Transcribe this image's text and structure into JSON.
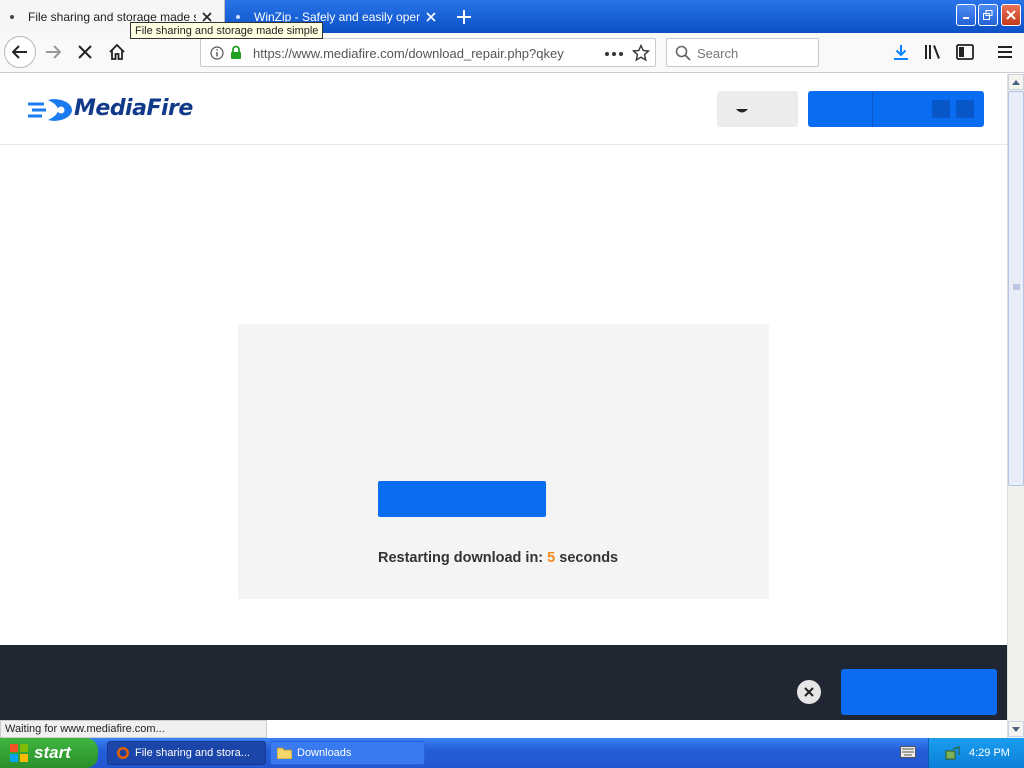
{
  "browser": {
    "tabs": [
      {
        "label": "File sharing and storage made simple",
        "active": true
      },
      {
        "label": "WinZip - Safely and easily open your",
        "active": false
      }
    ],
    "tooltip": "File sharing and storage made simple",
    "url": "https://www.mediafire.com/download_repair.php?qkey",
    "search_placeholder": "Search",
    "status_text": "Waiting for www.mediafire.com..."
  },
  "page": {
    "logo_text": "MediaFire",
    "restart_label": "Restarting download in:",
    "countdown": "5",
    "seconds_label": "seconds"
  },
  "taskbar": {
    "start_label": "start",
    "items": [
      {
        "label": "File sharing and stora..."
      },
      {
        "label": "Downloads"
      }
    ],
    "clock": "4:29 PM"
  },
  "colors": {
    "mediafire_blue": "#0a6cf0",
    "countdown_orange": "#f58a1f",
    "footer_dark": "#202632"
  }
}
